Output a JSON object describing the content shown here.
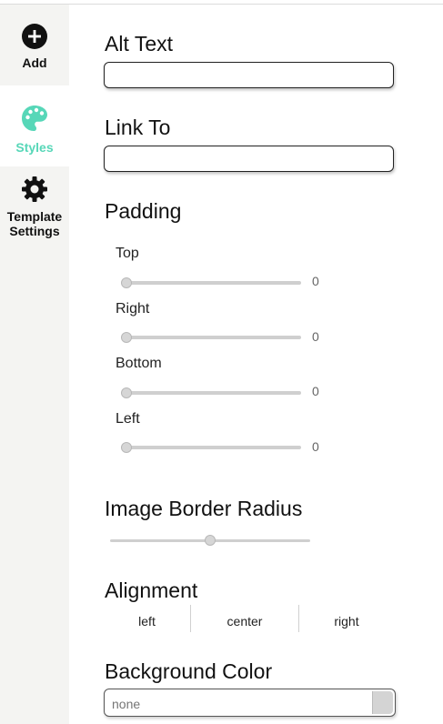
{
  "sidebar": {
    "items": [
      {
        "label": "Add",
        "icon": "plus-circle-icon",
        "active": false
      },
      {
        "label": "Styles",
        "icon": "palette-icon",
        "active": true
      },
      {
        "label": "Template\nSettings",
        "icon": "gear-icon",
        "active": false
      }
    ],
    "active_color": "#57d7b8"
  },
  "fields": {
    "alt_text": {
      "label": "Alt Text",
      "value": ""
    },
    "link_to": {
      "label": "Link To",
      "value": ""
    }
  },
  "padding": {
    "label": "Padding",
    "sides": [
      {
        "label": "Top",
        "value": "0",
        "level": 0
      },
      {
        "label": "Right",
        "value": "0",
        "level": 0
      },
      {
        "label": "Bottom",
        "value": "0",
        "level": 0
      },
      {
        "label": "Left",
        "value": "0",
        "level": 0
      }
    ]
  },
  "border_radius": {
    "label": "Image Border Radius",
    "level": 0.5
  },
  "alignment": {
    "label": "Alignment",
    "options": [
      "left",
      "center",
      "right"
    ]
  },
  "background_color": {
    "label": "Background Color",
    "placeholder": "none",
    "value": ""
  }
}
